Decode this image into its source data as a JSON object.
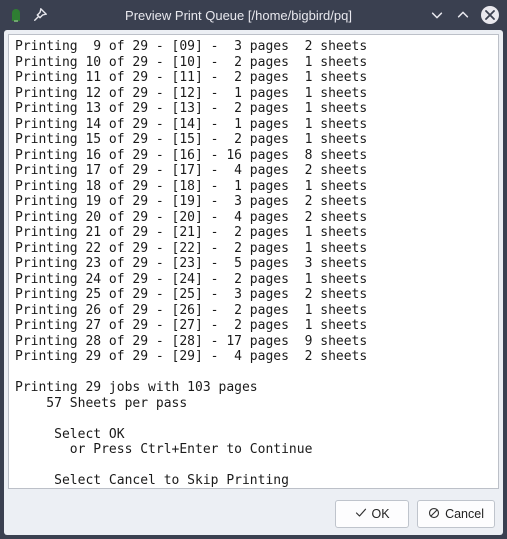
{
  "titlebar": {
    "title": "Preview Print Queue  [/home/bigbird/pq]"
  },
  "log": {
    "total_jobs": 29,
    "lines": [
      {
        "idx": 9,
        "id": "09",
        "pages": 3,
        "sheets": 2
      },
      {
        "idx": 10,
        "id": "10",
        "pages": 2,
        "sheets": 1
      },
      {
        "idx": 11,
        "id": "11",
        "pages": 2,
        "sheets": 1
      },
      {
        "idx": 12,
        "id": "12",
        "pages": 1,
        "sheets": 1
      },
      {
        "idx": 13,
        "id": "13",
        "pages": 2,
        "sheets": 1
      },
      {
        "idx": 14,
        "id": "14",
        "pages": 1,
        "sheets": 1
      },
      {
        "idx": 15,
        "id": "15",
        "pages": 2,
        "sheets": 1
      },
      {
        "idx": 16,
        "id": "16",
        "pages": 16,
        "sheets": 8
      },
      {
        "idx": 17,
        "id": "17",
        "pages": 4,
        "sheets": 2
      },
      {
        "idx": 18,
        "id": "18",
        "pages": 1,
        "sheets": 1
      },
      {
        "idx": 19,
        "id": "19",
        "pages": 3,
        "sheets": 2
      },
      {
        "idx": 20,
        "id": "20",
        "pages": 4,
        "sheets": 2
      },
      {
        "idx": 21,
        "id": "21",
        "pages": 2,
        "sheets": 1
      },
      {
        "idx": 22,
        "id": "22",
        "pages": 2,
        "sheets": 1
      },
      {
        "idx": 23,
        "id": "23",
        "pages": 5,
        "sheets": 3
      },
      {
        "idx": 24,
        "id": "24",
        "pages": 2,
        "sheets": 1
      },
      {
        "idx": 25,
        "id": "25",
        "pages": 3,
        "sheets": 2
      },
      {
        "idx": 26,
        "id": "26",
        "pages": 2,
        "sheets": 1
      },
      {
        "idx": 27,
        "id": "27",
        "pages": 2,
        "sheets": 1
      },
      {
        "idx": 28,
        "id": "28",
        "pages": 17,
        "sheets": 9
      },
      {
        "idx": 29,
        "id": "29",
        "pages": 4,
        "sheets": 2
      }
    ],
    "summary1": "Printing 29 jobs with 103 pages",
    "summary2": "    57 Sheets per pass",
    "prompt1": "     Select OK",
    "prompt2": "       or Press Ctrl+Enter to Continue",
    "prompt3": "     Select Cancel to Skip Printing"
  },
  "buttons": {
    "ok": "OK",
    "cancel": "Cancel"
  }
}
